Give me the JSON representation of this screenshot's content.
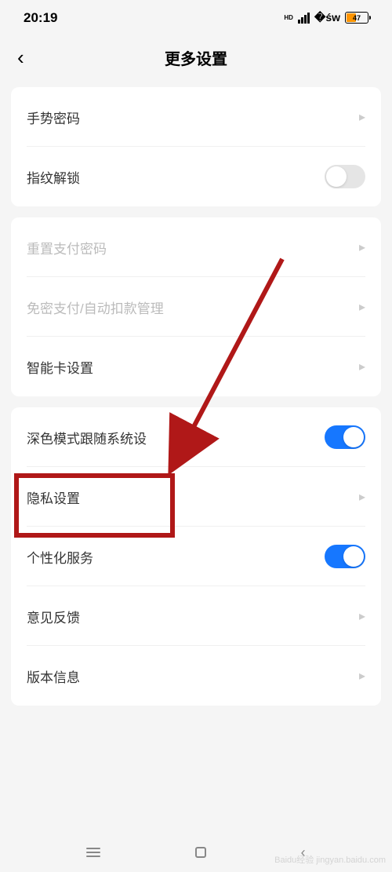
{
  "status": {
    "time": "20:19",
    "battery": "47"
  },
  "header": {
    "title": "更多设置"
  },
  "group1": {
    "gesture_password": "手势密码",
    "fingerprint_unlock": "指纹解锁"
  },
  "group2": {
    "reset_payment_password": "重置支付密码",
    "password_free_payment": "免密支付/自动扣款管理",
    "smart_card_settings": "智能卡设置"
  },
  "group3": {
    "dark_mode_follow_system": "深色模式跟随系统设",
    "privacy_settings": "隐私设置",
    "personalized_services": "个性化服务",
    "feedback": "意见反馈",
    "version_info": "版本信息"
  },
  "watermark": "Baidu经验 jingyan.baidu.com",
  "annotations": {
    "highlighted_item": "隐私设置",
    "arrow_target": "privacy-settings-item"
  }
}
